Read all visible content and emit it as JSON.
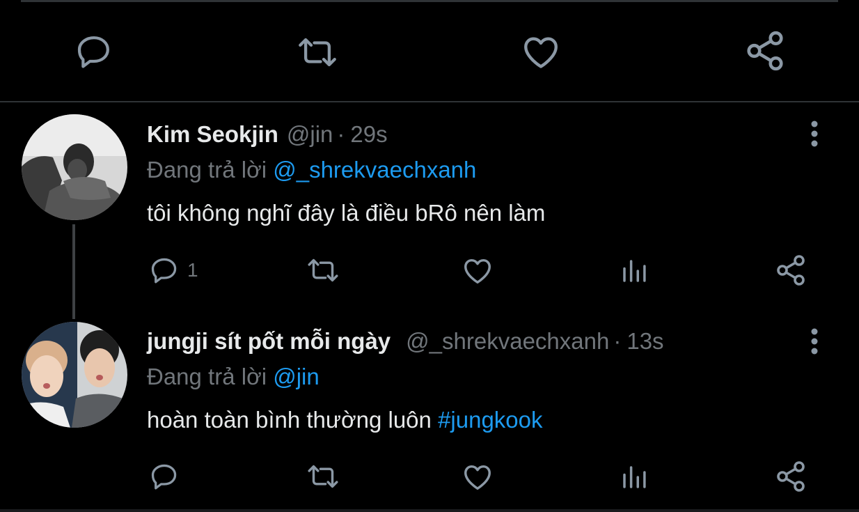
{
  "top_actions": {
    "reply_icon": "reply-icon",
    "retweet_icon": "retweet-icon",
    "like_icon": "heart-icon",
    "share_icon": "share-icon"
  },
  "tweets": [
    {
      "display_name": "Kim Seokjin",
      "handle": "@jin",
      "separator": "·",
      "time": "29s",
      "reply_prefix": "Đang trả lời",
      "reply_to": "@_shrekvaechxanh",
      "text": "tôi không nghĩ đây là điều bRô nên làm",
      "hashtag": "",
      "reply_count": "1"
    },
    {
      "display_name": "jungji sít pốt mỗi ngày",
      "handle": "@_shrekvaechxanh",
      "separator": "·",
      "time": "13s",
      "reply_prefix": "Đang trả lời",
      "reply_to": "@jin",
      "text": "hoàn toàn bình thường luôn",
      "hashtag": "#jungkook",
      "reply_count": ""
    }
  ],
  "colors": {
    "background": "#000000",
    "text_primary": "#e7e9ea",
    "text_secondary": "#71767b",
    "link": "#1d9bf0",
    "divider": "#2f3336"
  }
}
